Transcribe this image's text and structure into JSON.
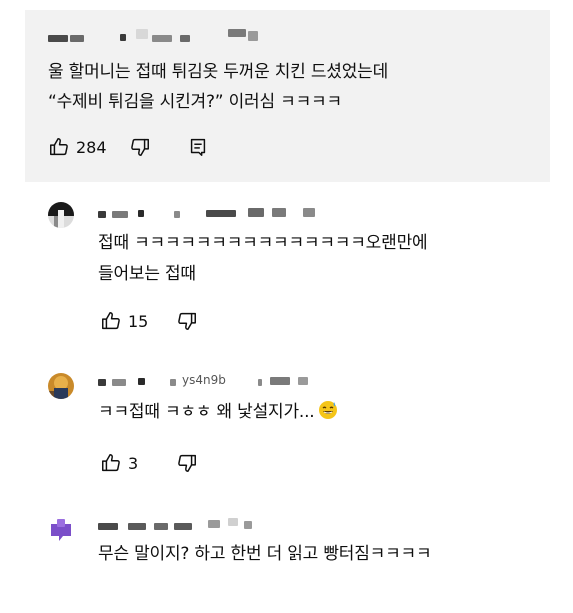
{
  "comments": [
    {
      "author_redacted": "",
      "lines": [
        "울 할머니는 접때 튀김옷 두꺼운 치킨 드셨었는데",
        "“수제비 튀김을 시킨겨?” 이러심 ㅋㅋㅋㅋ"
      ],
      "likes": "284"
    },
    {
      "author_redacted": "",
      "lines": [
        "접때 ㅋㅋㅋㅋㅋㅋㅋㅋㅋㅋㅋㅋㅋㅋㅋ오랜만에",
        "들어보는 접때"
      ],
      "likes": "15"
    },
    {
      "author_fragment": "ys4n9b",
      "lines": [
        "ㅋㅋ접때 ㅋㅎㅎ 왜 낯설지가..."
      ],
      "emoji": "sweat-smile-emoji",
      "likes": "3"
    },
    {
      "author_redacted": "",
      "lines": [
        "무슨 말이지? 하고 한번 더 읽고 빵터짐ㅋㅋㅋㅋ"
      ]
    }
  ],
  "icons": {
    "like": "thumbs-up-icon",
    "dislike": "thumbs-down-icon",
    "reply": "comment-reply-icon"
  },
  "colors": {
    "highlight_background": "#f2f2f2",
    "text": "#0f0f0f",
    "redaction": "#5a5a5a"
  }
}
